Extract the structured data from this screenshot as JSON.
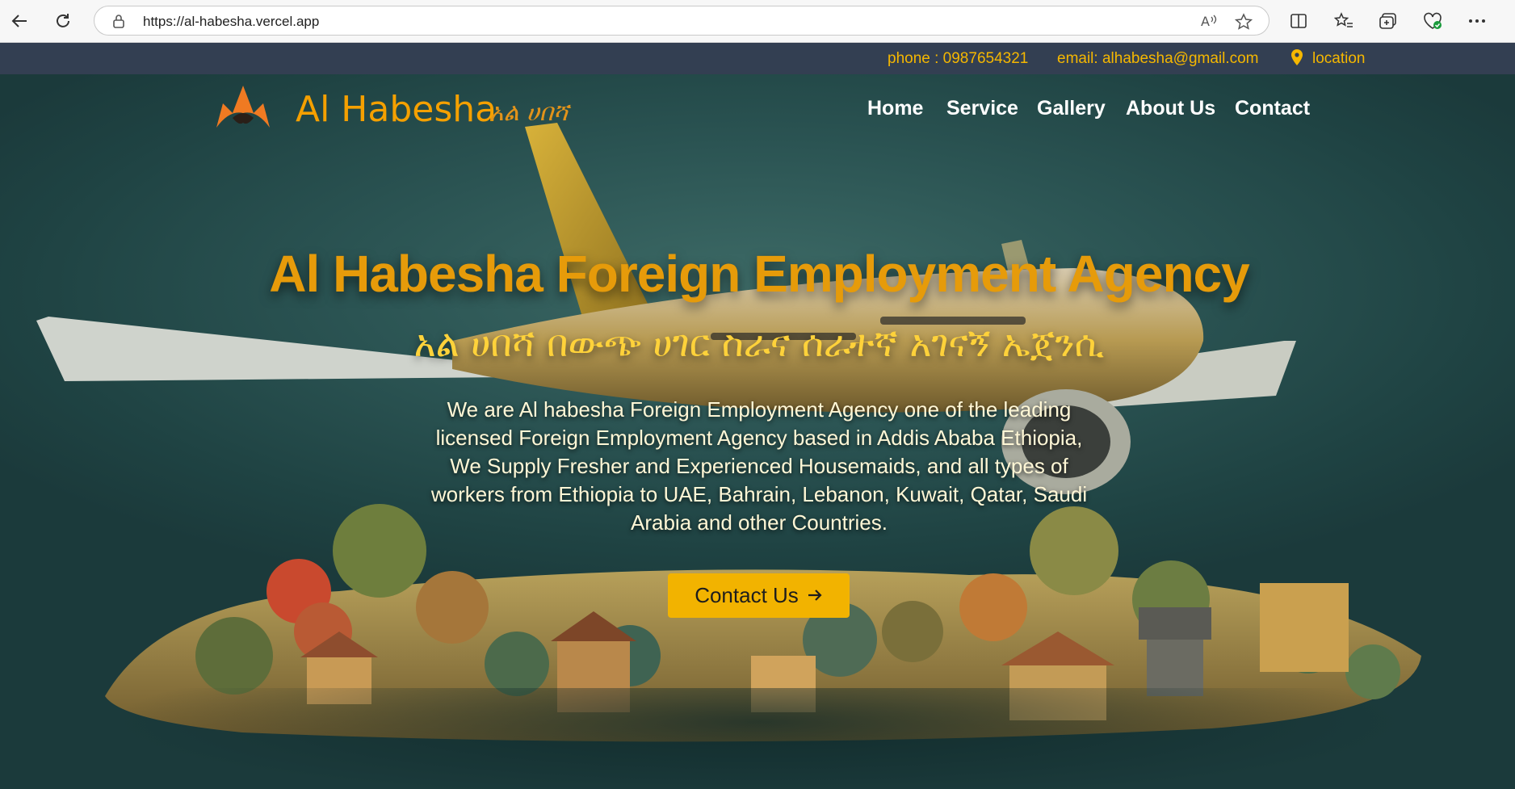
{
  "browser": {
    "url": "https://al-habesha.vercel.app"
  },
  "topbar": {
    "phone": "phone : 0987654321",
    "email": "email: alhabesha@gmail.com",
    "location": "location"
  },
  "header": {
    "brand_en": "Al Habesha",
    "brand_am": "አል ሀበሻ",
    "nav": [
      "Home",
      "Service",
      "Gallery",
      "About Us",
      "Contact"
    ]
  },
  "hero": {
    "title": "Al Habesha Foreign Employment Agency",
    "title_am": "አል ሀበሻ በውጭ ሀገር ስራና ሰራተኛ አገናኝ ኤጀንሲ",
    "description": "We are Al habesha Foreign Employment Agency one of the leading licensed Foreign Employment Agency based in Addis Ababa Ethiopia, We Supply Fresher and Experienced Housemaids, and all types of workers from Ethiopia to UAE, Bahrain, Lebanon, Kuwait, Qatar, Saudi Arabia and other Countries.",
    "cta": "Contact Us"
  },
  "colors": {
    "accent": "#f2b300",
    "brand": "#f5a000",
    "topbar_bg": "#333f52"
  }
}
